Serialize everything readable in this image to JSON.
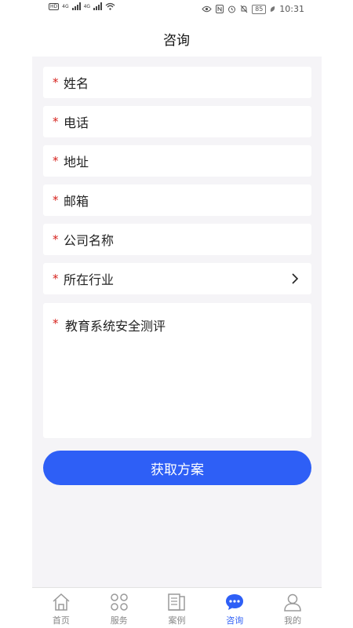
{
  "status_bar": {
    "network_1": "4G",
    "network_2": "4G",
    "battery": "85",
    "time": "10:31"
  },
  "header": {
    "title": "咨询"
  },
  "form": {
    "required_mark": "*",
    "fields": [
      {
        "label": "姓名"
      },
      {
        "label": "电话"
      },
      {
        "label": "地址"
      },
      {
        "label": "邮箱"
      },
      {
        "label": "公司名称"
      },
      {
        "label": "所在行业"
      }
    ],
    "textarea_label": "教育系统安全测评",
    "submit_label": "获取方案"
  },
  "tabbar": {
    "active_color": "#2e5ff6",
    "items": [
      {
        "label": "首页",
        "icon": "home-icon"
      },
      {
        "label": "服务",
        "icon": "grid-icon"
      },
      {
        "label": "案例",
        "icon": "document-icon"
      },
      {
        "label": "咨询",
        "icon": "chat-icon"
      },
      {
        "label": "我的",
        "icon": "user-icon"
      }
    ]
  }
}
